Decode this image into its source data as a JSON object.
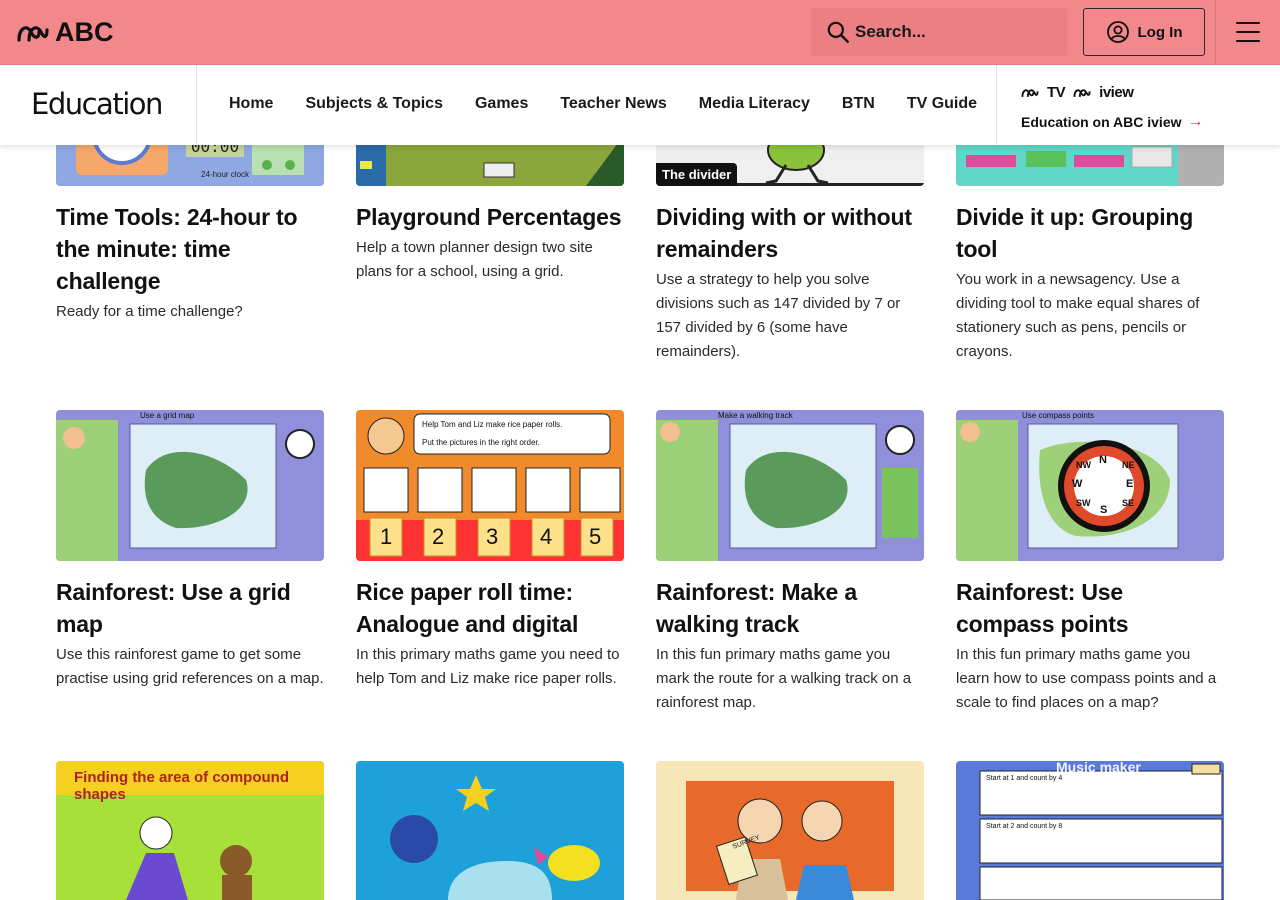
{
  "header": {
    "logo_text": "ABC",
    "search_placeholder": "Search...",
    "login_label": "Log In"
  },
  "subnav": {
    "section_title": "Education",
    "links": [
      "Home",
      "Subjects & Topics",
      "Games",
      "Teacher News",
      "Media Literacy",
      "BTN",
      "TV Guide"
    ],
    "iview_brand_tv": "TV",
    "iview_brand_iview": "iview",
    "iview_link": "Education on ABC iview"
  },
  "cards_row1": [
    {
      "title": "Time Tools: 24-hour to the minute: time challenge",
      "desc": "Ready for a time challenge?",
      "thumb_text": "24-hour clock"
    },
    {
      "title": "Playground Percentages",
      "desc": "Help a town planner design two site plans for a school, using a grid."
    },
    {
      "title": "Dividing with or without remainders",
      "desc": "Use a strategy to help you solve divisions such as 147 divided by 7 or 157 divided by 6 (some have remainders).",
      "tag": "The divider"
    },
    {
      "title": "Divide it up: Grouping tool",
      "desc": "You work in a newsagency. Use a dividing tool to make equal shares of stationery such as pens, pencils or crayons."
    }
  ],
  "cards_row2": [
    {
      "title": "Rainforest: Use a grid map",
      "desc": "Use this rainforest game to get some practise using grid references on a map.",
      "thumb_label": "Use a grid map"
    },
    {
      "title": "Rice paper roll time: Analogue and digital",
      "desc": "In this primary maths game you need to help Tom and Liz make rice paper rolls.",
      "bubble_line1": "Help Tom and Liz make rice paper rolls.",
      "bubble_line2": "Put the pictures in the right order.",
      "numbers": [
        "1",
        "2",
        "3",
        "4",
        "5"
      ]
    },
    {
      "title": "Rainforest: Make a walking track",
      "desc": "In this fun primary maths game you mark the route for a walking track on a rainforest map.",
      "thumb_label": "Make a walking track"
    },
    {
      "title": "Rainforest: Use compass points",
      "desc": "In this fun primary maths game you learn how to use compass points and a scale to find places on a map?",
      "thumb_label": "Use compass points",
      "compass": [
        "N",
        "NE",
        "E",
        "SE",
        "S",
        "SW",
        "W",
        "NW"
      ]
    }
  ],
  "cards_row3": [
    {
      "thumb_label": "Finding the area of compound shapes"
    },
    {
      "thumb_label": ""
    },
    {
      "thumb_label": "SURVEY"
    },
    {
      "thumb_label": "Music maker",
      "line1": "Start at 1 and count by 4",
      "line2": "Start at 2 and count by 8"
    }
  ],
  "colors": {
    "header_bg": "#f2888c",
    "link_arrow": "#d93a3a",
    "rainforest_bg": "#8f8fdc",
    "rice_bg": "#f08a2a"
  }
}
